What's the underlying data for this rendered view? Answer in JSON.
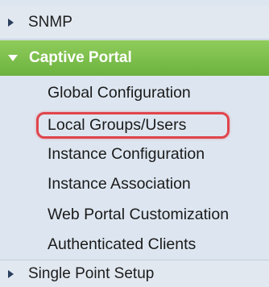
{
  "nav": {
    "snmp": {
      "label": "SNMP"
    },
    "captive_portal": {
      "label": "Captive Portal",
      "items": [
        {
          "label": "Global Configuration"
        },
        {
          "label": "Local Groups/Users"
        },
        {
          "label": "Instance Configuration"
        },
        {
          "label": "Instance Association"
        },
        {
          "label": "Web Portal Customization"
        },
        {
          "label": "Authenticated Clients"
        }
      ]
    },
    "single_point_setup": {
      "label": "Single Point Setup"
    }
  },
  "highlighted_item": "Local Groups/Users",
  "colors": {
    "header_active": "#7cbf4c",
    "highlight_ring": "#e0454d",
    "panel_bg": "#dde6f0"
  }
}
